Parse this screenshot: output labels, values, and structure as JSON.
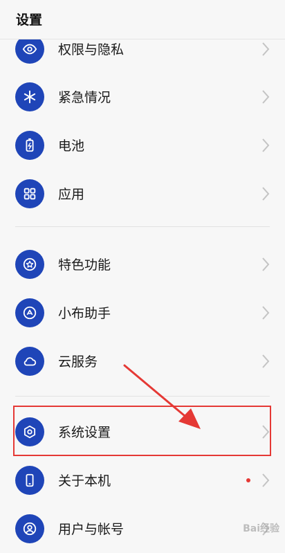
{
  "header": {
    "title": "设置"
  },
  "items": [
    {
      "label": "权限与隐私",
      "icon": "privacy-eye-icon"
    },
    {
      "label": "紧急情况",
      "icon": "emergency-asterisk-icon"
    },
    {
      "label": "电池",
      "icon": "battery-icon"
    },
    {
      "label": "应用",
      "icon": "apps-grid-icon"
    },
    {
      "label": "特色功能",
      "icon": "star-feature-icon"
    },
    {
      "label": "小布助手",
      "icon": "assistant-icon"
    },
    {
      "label": "云服务",
      "icon": "cloud-icon"
    },
    {
      "label": "系统设置",
      "icon": "system-settings-icon"
    },
    {
      "label": "关于本机",
      "icon": "phone-icon",
      "badge": "red-dot"
    },
    {
      "label": "用户与帐号",
      "icon": "user-account-icon"
    }
  ],
  "colors": {
    "icon_background": "#1f45b8",
    "highlight_border": "#e53935",
    "annotation_arrow": "#e53935",
    "badge_dot": "#e53935"
  },
  "watermark": {
    "text": "Bai经验"
  }
}
